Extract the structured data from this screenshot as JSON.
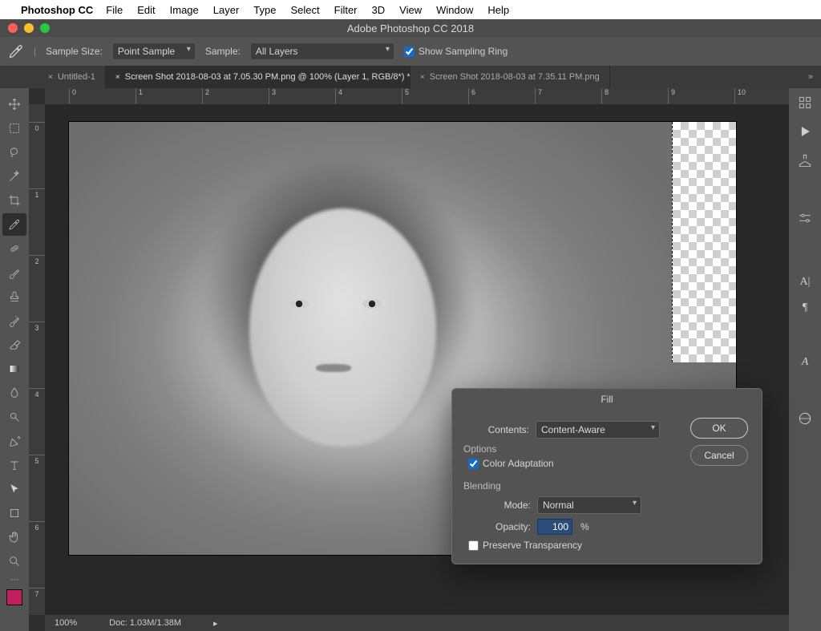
{
  "menubar": {
    "app": "Photoshop CC",
    "items": [
      "File",
      "Edit",
      "Image",
      "Layer",
      "Type",
      "Select",
      "Filter",
      "3D",
      "View",
      "Window",
      "Help"
    ]
  },
  "window_title": "Adobe Photoshop CC 2018",
  "options_bar": {
    "sample_size_label": "Sample Size:",
    "sample_size_value": "Point Sample",
    "sample_label": "Sample:",
    "sample_value": "All Layers",
    "show_ring": "Show Sampling Ring"
  },
  "tabs": [
    {
      "label": "Untitled-1",
      "active": false
    },
    {
      "label": "Screen Shot 2018-08-03 at 7.05.30 PM.png @ 100% (Layer 1, RGB/8*) *",
      "active": true
    },
    {
      "label": "Screen Shot 2018-08-03 at 7.35.11 PM.png",
      "active": false
    }
  ],
  "hruler": [
    "0",
    "1",
    "2",
    "3",
    "4",
    "5",
    "6",
    "7",
    "8",
    "9",
    "10"
  ],
  "vruler": [
    "0",
    "1",
    "2",
    "3",
    "4",
    "5",
    "6",
    "7"
  ],
  "status": {
    "zoom": "100%",
    "doc": "Doc: 1.03M/1.38M"
  },
  "tools": [
    "move",
    "rect-select",
    "lasso",
    "magic-wand",
    "crop",
    "eyedropper",
    "heal",
    "brush",
    "stamp",
    "history-brush",
    "eraser",
    "gradient",
    "blur",
    "dodge",
    "pen",
    "type",
    "path-select",
    "rect-shape",
    "hand",
    "zoom"
  ],
  "dialog": {
    "title": "Fill",
    "contents_label": "Contents:",
    "contents_value": "Content-Aware",
    "options_label": "Options",
    "color_adapt": "Color Adaptation",
    "blending_label": "Blending",
    "mode_label": "Mode:",
    "mode_value": "Normal",
    "opacity_label": "Opacity:",
    "opacity_value": "100",
    "opacity_unit": "%",
    "preserve": "Preserve Transparency",
    "ok": "OK",
    "cancel": "Cancel"
  }
}
